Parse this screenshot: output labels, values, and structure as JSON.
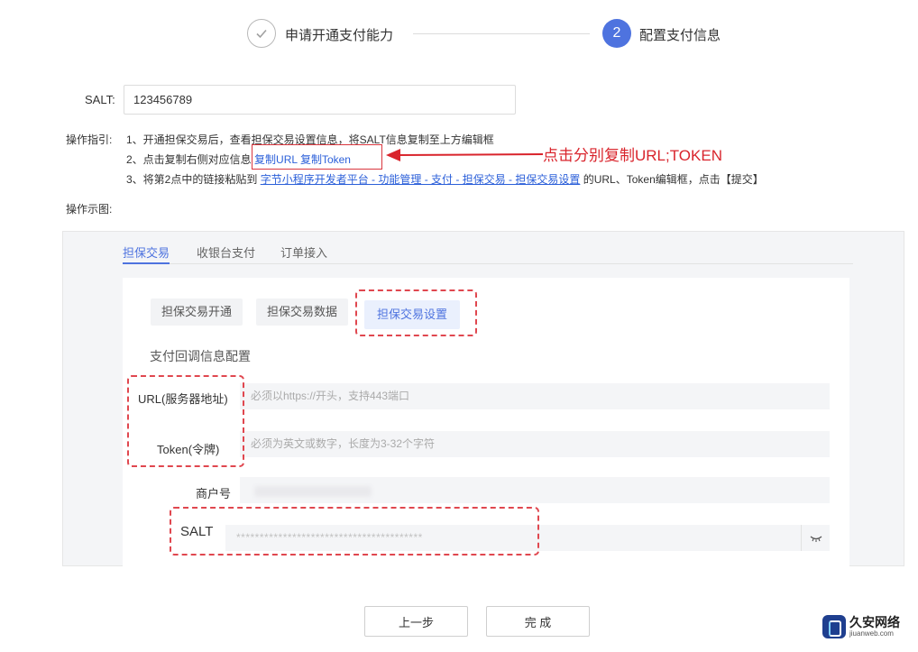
{
  "steps": [
    {
      "label": "申请开通支付能力",
      "status": "done"
    },
    {
      "number": "2",
      "label": "配置支付信息",
      "status": "active"
    }
  ],
  "salt_field": {
    "label": "SALT:",
    "value": "123456789"
  },
  "guide": {
    "label": "操作指引:",
    "line1": "1、开通担保交易后，查看担保交易设置信息，将SALT信息复制至上方编辑框",
    "line2_prefix": "2、点击复制右侧对应信息",
    "copy_url": "复制URL",
    "copy_token": "复制Token",
    "line3_prefix": "3、将第2点中的链接粘贴到",
    "line3_link": "字节小程序开发者平台 - 功能管理 - 支付 - 担保交易 - 担保交易设置",
    "line3_suffix": "的URL、Token编辑框，点击【提交】",
    "demo_label": "操作示图:"
  },
  "annotation": "点击分别复制URL;TOKEN",
  "demo": {
    "tabs": [
      "担保交易",
      "收银台支付",
      "订单接入"
    ],
    "subtabs": [
      "担保交易开通",
      "担保交易数据",
      "担保交易设置"
    ],
    "section_title": "支付回调信息配置",
    "fields": [
      {
        "label": "URL(服务器地址)",
        "placeholder": "必须以https://开头，支持443端口"
      },
      {
        "label": "Token(令牌)",
        "placeholder": "必须为英文或数字，长度为3-32个字符"
      },
      {
        "label": "商户号",
        "placeholder": ""
      },
      {
        "label": "SALT",
        "placeholder": "****************************************"
      }
    ]
  },
  "buttons": {
    "prev": "上一步",
    "done": "完 成"
  },
  "watermark": {
    "name": "久安网络",
    "url": "jiuanweb.com"
  },
  "colors": {
    "primary": "#4e73df",
    "annotation_red": "#d9242c"
  }
}
